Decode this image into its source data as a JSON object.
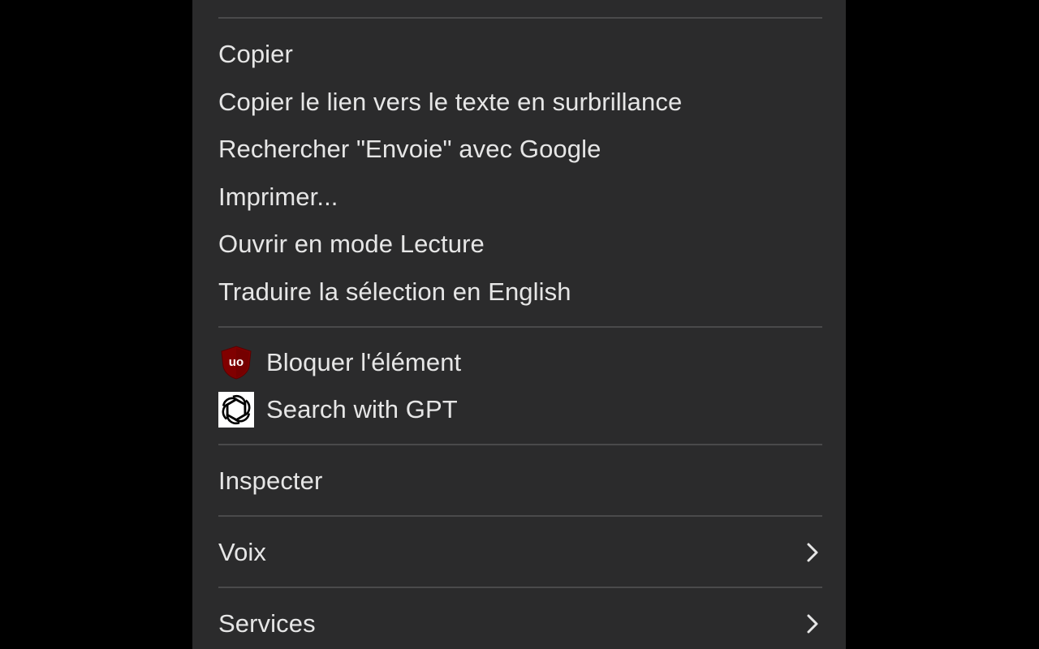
{
  "menu": {
    "items": [
      {
        "label": "Copier"
      },
      {
        "label": "Copier le lien vers le texte en surbrillance"
      },
      {
        "label": "Rechercher \"Envoie\" avec Google"
      },
      {
        "label": "Imprimer..."
      },
      {
        "label": "Ouvrir en mode Lecture"
      },
      {
        "label": "Traduire la sélection en English"
      },
      {
        "label": "Bloquer l'élément",
        "icon": "ublock-origin-icon"
      },
      {
        "label": "Search with GPT",
        "icon": "openai-logo-icon"
      },
      {
        "label": "Inspecter"
      },
      {
        "label": "Voix",
        "icon": "chevron-right-icon"
      },
      {
        "label": "Services",
        "icon": "chevron-right-icon"
      }
    ]
  },
  "colors": {
    "menu_background": "#2b2b2c",
    "text": "#e6e6e6",
    "separator": "#4a4a4b",
    "ublock_red": "#800000"
  }
}
